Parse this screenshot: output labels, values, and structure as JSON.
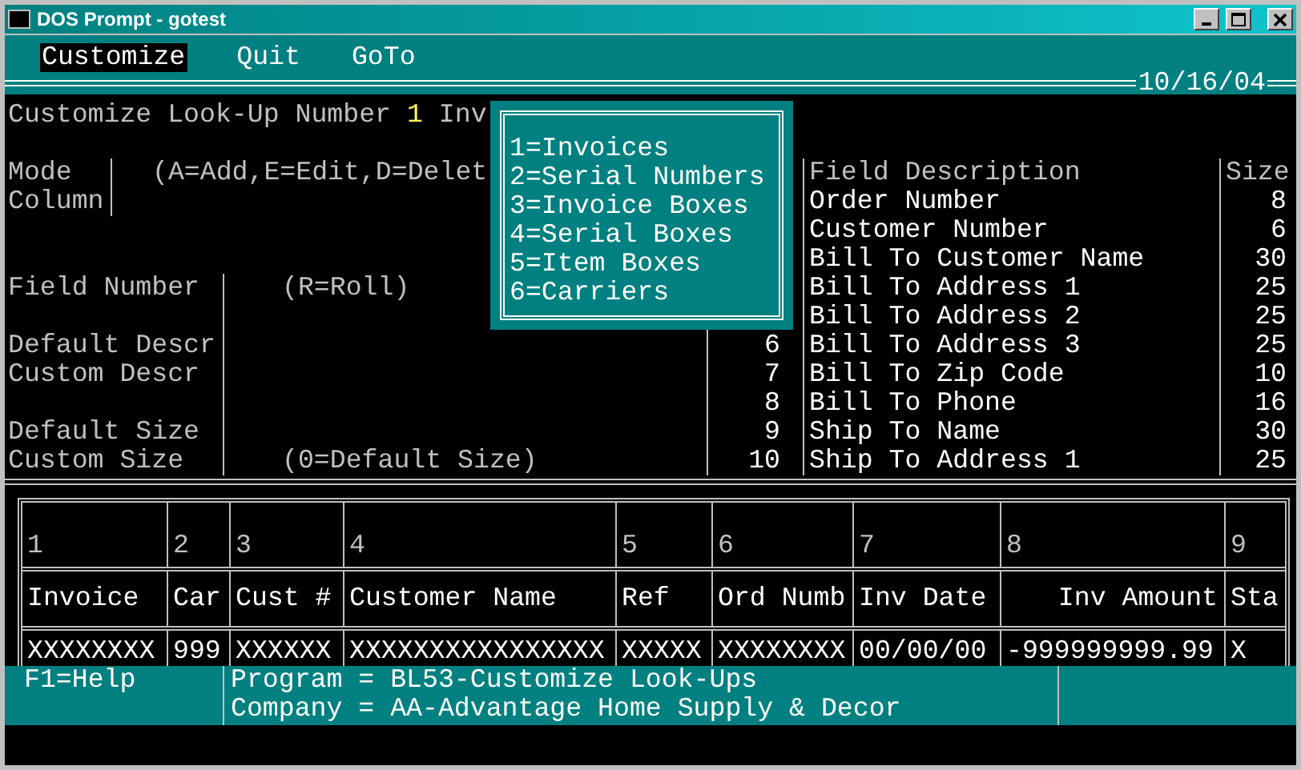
{
  "window": {
    "title": "DOS Prompt - gotest"
  },
  "menu": [
    {
      "label": "Customize",
      "selected": true
    },
    {
      "label": "Quit",
      "selected": false
    },
    {
      "label": "GoTo",
      "selected": false
    }
  ],
  "date": "10/16/04",
  "prompt": {
    "label": "Customize Look-Up Number",
    "value": "1",
    "text": "Inv"
  },
  "popup": {
    "items": [
      "1=Invoices",
      "2=Serial Numbers",
      "3=Invoice Boxes",
      "4=Serial Boxes",
      "5=Item Boxes",
      "6=Carriers"
    ]
  },
  "mode_section": {
    "rows": [
      {
        "label": "Mode",
        "hint": "(A=Add,E=Edit,D=Delet"
      },
      {
        "label": "Column"
      }
    ]
  },
  "field_section": {
    "rows": [
      {
        "label": "Field Number",
        "hint": "(R=Roll)"
      },
      {
        "label": "Default Descr"
      },
      {
        "label": "Custom Descr"
      },
      {
        "label": "Default Size"
      },
      {
        "label": "Custom Size",
        "hint": "(0=Default Size)"
      }
    ]
  },
  "field_list": {
    "columns": [
      "Field Description",
      "Size"
    ],
    "rows": [
      {
        "description": "Order Number",
        "size": "8"
      },
      {
        "description": "Customer Number",
        "size": "6"
      },
      {
        "description": "Bill To Customer Name",
        "size": "30"
      },
      {
        "description": "Bill To Address 1",
        "size": "25"
      },
      {
        "description": "Bill To Address 2",
        "size": "25"
      },
      {
        "number": "6",
        "description": "Bill To Address 3",
        "size": "25"
      },
      {
        "number": "7",
        "description": "Bill To Zip Code",
        "size": "10"
      },
      {
        "number": "8",
        "description": "Bill To Phone",
        "size": "16"
      },
      {
        "number": "9",
        "description": "Ship To Name",
        "size": "30"
      },
      {
        "number": "10",
        "description": "Ship To Address 1",
        "size": "25"
      }
    ]
  },
  "table": {
    "columns": [
      {
        "number": "1",
        "heading": "Invoice",
        "sample": "XXXXXXXX"
      },
      {
        "number": "2",
        "heading": "Car",
        "sample": "999"
      },
      {
        "number": "3",
        "heading": "Cust #",
        "sample": "XXXXXX"
      },
      {
        "number": "4",
        "heading": "Customer Name",
        "sample": "XXXXXXXXXXXXXXXX"
      },
      {
        "number": "5",
        "heading": "Ref",
        "sample": "XXXXX"
      },
      {
        "number": "6",
        "heading": "Ord Numb",
        "sample": "XXXXXXXX"
      },
      {
        "number": "7",
        "heading": "Inv Date",
        "sample": "00/00/00"
      },
      {
        "number": "8",
        "heading": "Inv Amount",
        "sample": "-999999999.99",
        "right_aligned": true
      },
      {
        "number": "9",
        "heading": "Sta",
        "sample": "X"
      }
    ]
  },
  "status_bar": {
    "help": "F1=Help",
    "lines": [
      "Program = BL53-Customize Look-Ups",
      "Company = AA-Advantage Home Supply & Decor"
    ]
  }
}
